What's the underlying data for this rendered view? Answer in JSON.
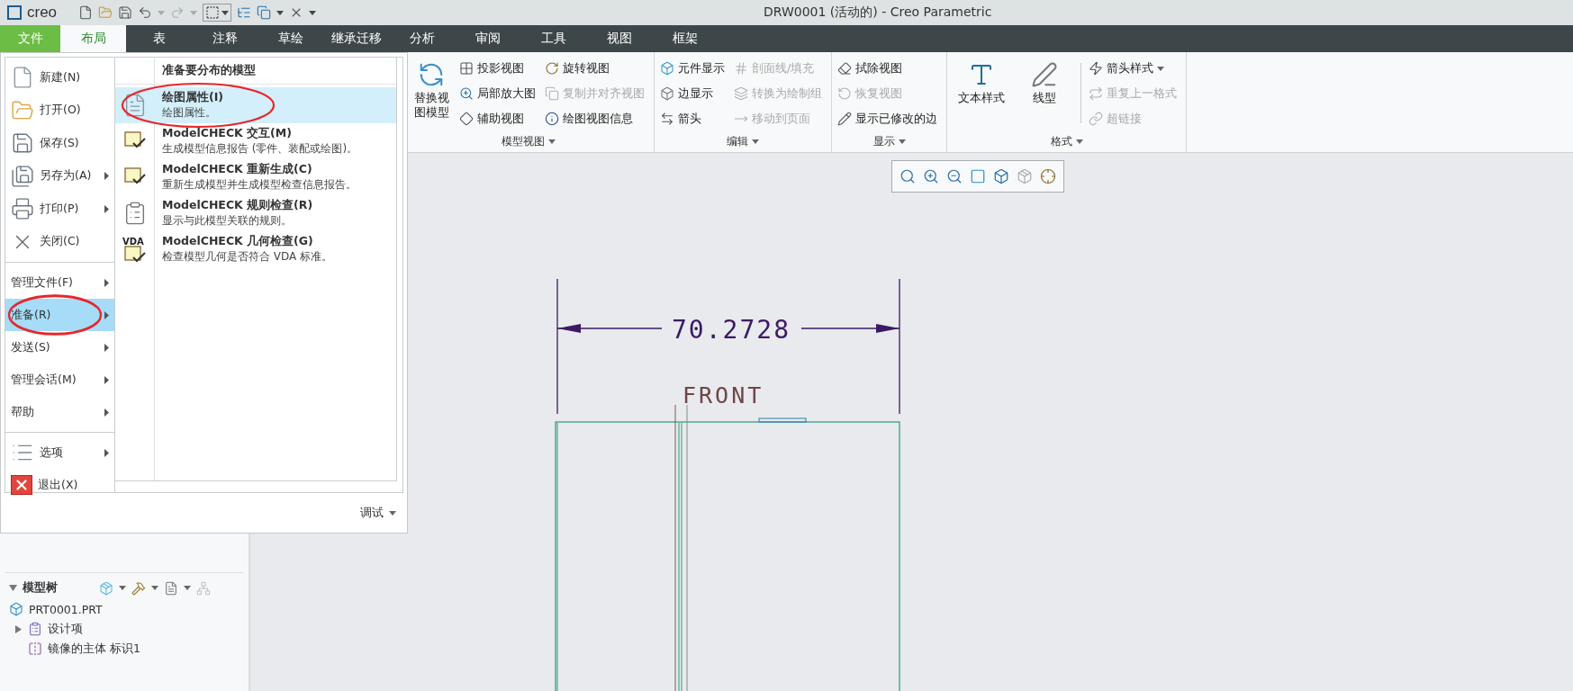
{
  "title_bar": {
    "logo_text": "creo",
    "title": "DRW0001 (活动的) - Creo Parametric"
  },
  "tabs": [
    {
      "label": "文件",
      "kind": "file",
      "selected": false
    },
    {
      "label": "布局",
      "kind": "tab",
      "selected": true
    },
    {
      "label": "表",
      "kind": "tab",
      "selected": false
    },
    {
      "label": "注释",
      "kind": "tab",
      "selected": false
    },
    {
      "label": "草绘",
      "kind": "tab",
      "selected": false
    },
    {
      "label": "继承迁移",
      "kind": "tab",
      "selected": false
    },
    {
      "label": "分析",
      "kind": "tab",
      "selected": false
    },
    {
      "label": "审阅",
      "kind": "tab",
      "selected": false
    },
    {
      "label": "工具",
      "kind": "tab",
      "selected": false
    },
    {
      "label": "视图",
      "kind": "tab",
      "selected": false
    },
    {
      "label": "框架",
      "kind": "tab",
      "selected": false
    }
  ],
  "ribbon": {
    "groups": [
      {
        "label": "模型视图",
        "columns": [
          {
            "kind": "large",
            "label": "替换视图模型",
            "disabled": false
          },
          {
            "kind": "stack",
            "items": [
              {
                "label": "投影视图",
                "disabled": false,
                "dropdown": false
              },
              {
                "label": "局部放大图",
                "disabled": false,
                "dropdown": false
              },
              {
                "label": "辅助视图",
                "disabled": false,
                "dropdown": false
              }
            ]
          },
          {
            "kind": "stack",
            "items": [
              {
                "label": "旋转视图",
                "disabled": false,
                "dropdown": false
              },
              {
                "label": "复制并对齐视图",
                "disabled": true,
                "dropdown": false
              },
              {
                "label": "绘图视图信息",
                "disabled": false,
                "dropdown": false
              }
            ]
          }
        ]
      },
      {
        "label": "编辑",
        "columns": [
          {
            "kind": "stack",
            "items": [
              {
                "label": "元件显示",
                "disabled": false,
                "dropdown": false
              },
              {
                "label": "边显示",
                "disabled": false,
                "dropdown": false
              },
              {
                "label": "箭头",
                "disabled": false,
                "dropdown": false
              }
            ]
          },
          {
            "kind": "stack",
            "items": [
              {
                "label": "剖面线/填充",
                "disabled": true,
                "dropdown": false
              },
              {
                "label": "转换为绘制组",
                "disabled": true,
                "dropdown": false
              },
              {
                "label": "移动到页面",
                "disabled": true,
                "dropdown": false
              }
            ]
          }
        ]
      },
      {
        "label": "显示",
        "columns": [
          {
            "kind": "stack",
            "items": [
              {
                "label": "拭除视图",
                "disabled": false,
                "dropdown": false
              },
              {
                "label": "恢复视图",
                "disabled": true,
                "dropdown": false
              },
              {
                "label": "显示已修改的边",
                "disabled": false,
                "dropdown": false
              }
            ]
          }
        ]
      },
      {
        "label": "格式",
        "columns": [
          {
            "kind": "large",
            "label": "文本样式",
            "disabled": false
          },
          {
            "kind": "large",
            "label": "线型",
            "disabled": false
          },
          {
            "kind": "separator"
          },
          {
            "kind": "stack",
            "items": [
              {
                "label": "箭头样式",
                "disabled": false,
                "dropdown": true
              },
              {
                "label": "重复上一格式",
                "disabled": true,
                "dropdown": false
              },
              {
                "label": "超链接",
                "disabled": true,
                "dropdown": false
              }
            ]
          }
        ]
      }
    ]
  },
  "file_menu": {
    "sections": [
      {
        "items": [
          {
            "label": "新建(N)",
            "kind": "icon",
            "submenu": false,
            "selected": false,
            "circled": false
          },
          {
            "label": "打开(O)",
            "kind": "icon",
            "submenu": false,
            "selected": false,
            "circled": false
          },
          {
            "label": "保存(S)",
            "kind": "icon",
            "submenu": false,
            "selected": false,
            "circled": false
          },
          {
            "label": "另存为(A)",
            "kind": "icon",
            "submenu": true,
            "selected": false,
            "circled": false
          },
          {
            "label": "打印(P)",
            "kind": "icon",
            "submenu": true,
            "selected": false,
            "circled": false
          },
          {
            "label": "关闭(C)",
            "kind": "icon",
            "submenu": false,
            "selected": false,
            "circled": false
          }
        ]
      },
      {
        "items": [
          {
            "label": "管理文件(F)",
            "kind": "text",
            "submenu": true,
            "selected": false,
            "circled": false
          },
          {
            "label": "准备(R)",
            "kind": "text",
            "submenu": true,
            "selected": true,
            "circled": true
          },
          {
            "label": "发送(S)",
            "kind": "text",
            "submenu": true,
            "selected": false,
            "circled": false
          },
          {
            "label": "管理会话(M)",
            "kind": "text",
            "submenu": true,
            "selected": false,
            "circled": false
          },
          {
            "label": "帮助",
            "kind": "text",
            "submenu": true,
            "selected": false,
            "circled": false
          }
        ]
      },
      {
        "items": [
          {
            "label": "选项",
            "kind": "icon",
            "submenu": true,
            "selected": false,
            "circled": false
          },
          {
            "label": "退出(X)",
            "kind": "icon",
            "submenu": false,
            "selected": false,
            "circled": false
          }
        ]
      }
    ],
    "panel": {
      "heading": "准备要分布的模型",
      "entries": [
        {
          "title": "绘图属性(I)",
          "description": "绘图属性。",
          "selected": true,
          "circled": true
        },
        {
          "title": "ModelCHECK 交互(M)",
          "description": "生成模型信息报告 (零件、装配或绘图)。",
          "selected": false,
          "circled": false
        },
        {
          "title": "ModelCHECK 重新生成(C)",
          "description": "重新生成模型并生成模型检查信息报告。",
          "selected": false,
          "circled": false
        },
        {
          "title": "ModelCHECK 规则检查(R)",
          "description": "显示与此模型关联的规则。",
          "selected": false,
          "circled": false
        },
        {
          "title": "ModelCHECK 几何检查(G)",
          "description": "检查模型几何是否符合 VDA 标准。",
          "selected": false,
          "circled": false,
          "badge": "VDA"
        }
      ]
    },
    "footer": "调试"
  },
  "model_tree": {
    "title": "模型树",
    "expanded": true,
    "items": [
      {
        "label": "PRT0001.PRT",
        "kind": "root"
      },
      {
        "label": "设计项",
        "kind": "node",
        "expanded": false
      },
      {
        "label": "镜像的主体 标识1",
        "kind": "leaf"
      }
    ]
  },
  "drawing": {
    "dimension": "70.2728",
    "view_label": "FRONT"
  }
}
